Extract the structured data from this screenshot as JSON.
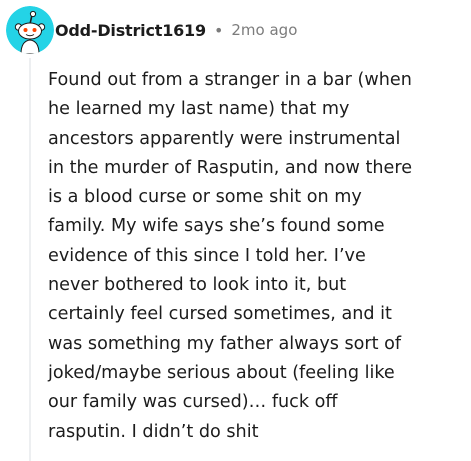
{
  "comment": {
    "author": "Odd-District1619",
    "separator": "•",
    "timestamp": "2mo ago",
    "avatar_icon": "snoo-avatar-icon",
    "text_lines": [
      "Found out from a stranger in a bar (when",
      "he learned my last name) that my",
      "ancestors apparently were instrumental",
      "in the murder of Rasputin, and now there",
      "is a blood curse or some shit on my",
      "family. My wife says she’s found some",
      "evidence of this since I told her. I’ve",
      "never bothered to look into it, but",
      "certainly feel cursed sometimes, and it",
      "was something my father always sort of",
      "joked/maybe serious about (feeling like",
      "our family was cursed)… fuck off",
      "rasputin. I didn’t do shit"
    ]
  },
  "colors": {
    "avatar_background": "#24d3e6",
    "snoo_body": "#ffffff",
    "text": "#1c1c1c",
    "meta": "#7c7c7c",
    "thread_line": "#edeff1"
  }
}
